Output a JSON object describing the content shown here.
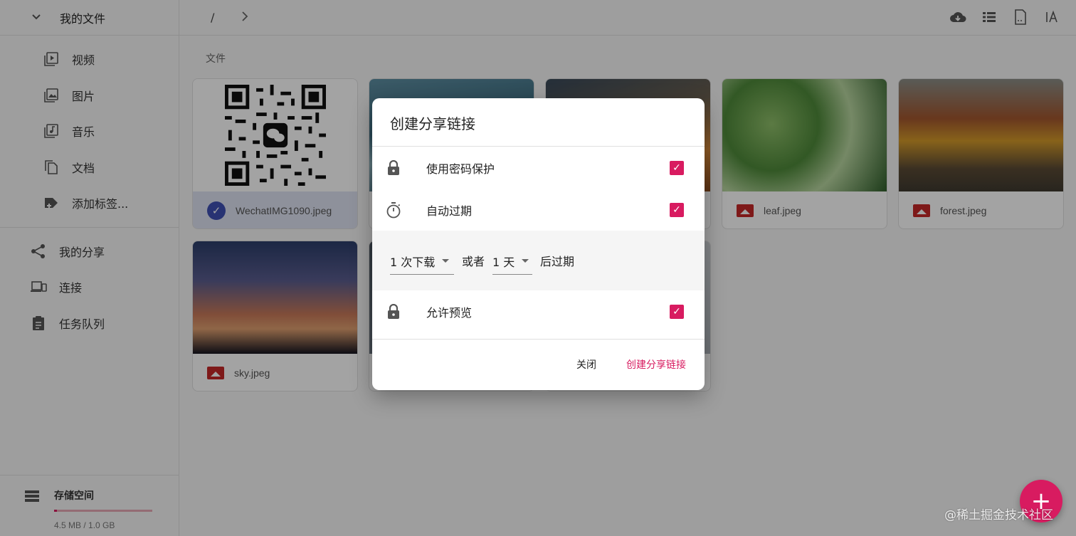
{
  "sidebar": {
    "root_label": "我的文件",
    "items": [
      {
        "label": "视频",
        "icon": "video-icon"
      },
      {
        "label": "图片",
        "icon": "image-icon"
      },
      {
        "label": "音乐",
        "icon": "music-icon"
      },
      {
        "label": "文档",
        "icon": "document-icon"
      },
      {
        "label": "添加标签...",
        "icon": "tag-add-icon"
      }
    ],
    "nav": [
      {
        "label": "我的分享",
        "icon": "share-icon"
      },
      {
        "label": "连接",
        "icon": "devices-icon"
      },
      {
        "label": "任务队列",
        "icon": "clipboard-icon"
      }
    ],
    "storage": {
      "title": "存储空间",
      "usage": "4.5 MB / 1.0 GB",
      "fill_fraction": 0.03
    }
  },
  "topbar": {
    "path_root": "/",
    "tools": [
      "cloud-download-icon",
      "list-view-icon",
      "file-settings-icon",
      "text-size-icon"
    ]
  },
  "main": {
    "section_label": "文件",
    "files": [
      {
        "name": "WechatIMG1090.jpeg",
        "selected": true
      },
      {
        "name": "",
        "selected": false
      },
      {
        "name": "",
        "selected": false
      },
      {
        "name": "leaf.jpeg",
        "selected": false
      },
      {
        "name": "forest.jpeg",
        "selected": false
      },
      {
        "name": "sky.jpeg",
        "selected": false
      }
    ]
  },
  "dialog": {
    "title": "创建分享链接",
    "options": [
      {
        "label": "使用密码保护",
        "icon": "lock-icon",
        "checked": true
      },
      {
        "label": "自动过期",
        "icon": "timer-icon",
        "checked": true
      },
      {
        "label": "允许预览",
        "icon": "lock-icon",
        "checked": true
      }
    ],
    "expire": {
      "downloads_value": "1 次下载",
      "or_text": "或者",
      "days_value": "1 天",
      "suffix": "后过期"
    },
    "close_label": "关闭",
    "create_label": "创建分享链接"
  },
  "fab": {
    "icon": "plus-icon",
    "symbol": "+"
  },
  "watermark": "@稀土掘金技术社区",
  "colors": {
    "accent": "#d81b60",
    "selected_bg": "#dfe3f3",
    "check_blue": "#3f51b5",
    "file_icon_red": "#c62828"
  }
}
